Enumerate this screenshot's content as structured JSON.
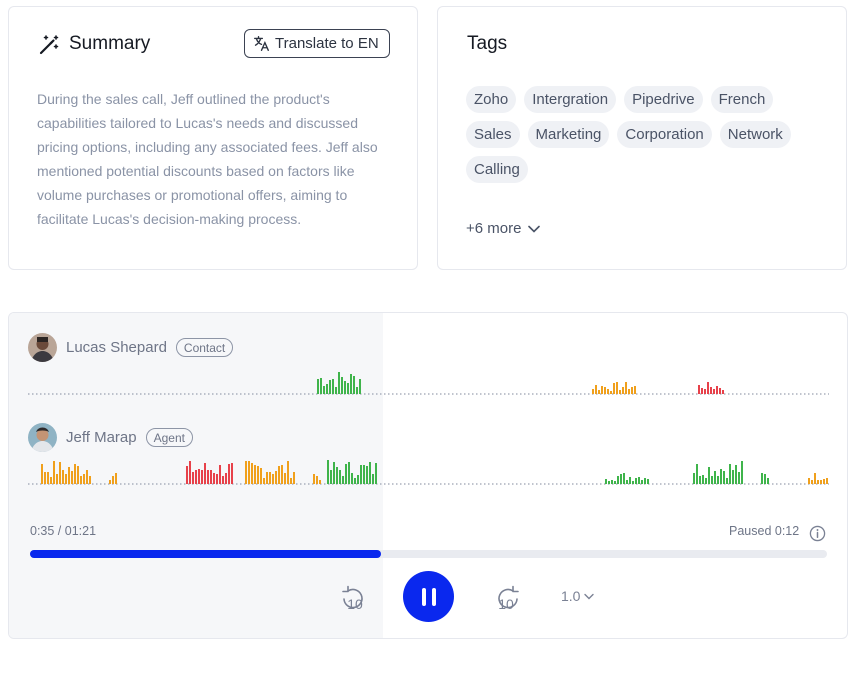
{
  "summary": {
    "title": "Summary",
    "translate_label": "Translate to EN",
    "text": "During the sales call, Jeff outlined the product's capabilities tailored to Lucas's needs and discussed pricing options, including any associated fees. Jeff also mentioned potential discounts based on factors like volume purchases or promotional offers, aiming to facilitate Lucas's decision-making process."
  },
  "tags": {
    "title": "Tags",
    "items": [
      "Zoho",
      "Intergration",
      "Pipedrive",
      "French",
      "Sales",
      "Marketing",
      "Corporation",
      "Network",
      "Calling"
    ],
    "more_label": "+6 more"
  },
  "player": {
    "speakers": [
      {
        "name": "Lucas Shepard",
        "role": "Contact"
      },
      {
        "name": "Jeff Marap",
        "role": "Agent"
      }
    ],
    "time_elapsed": "0:35 / 01:21",
    "paused_label": "Paused 0:12",
    "progress_fraction": 0.44,
    "rewind_seconds": "10",
    "forward_seconds": "10",
    "speed": "1.0"
  },
  "colors": {
    "accent": "#0a28ee",
    "positive": "#3fb44b",
    "neutral": "#f0a01c",
    "negative": "#e7414a"
  }
}
